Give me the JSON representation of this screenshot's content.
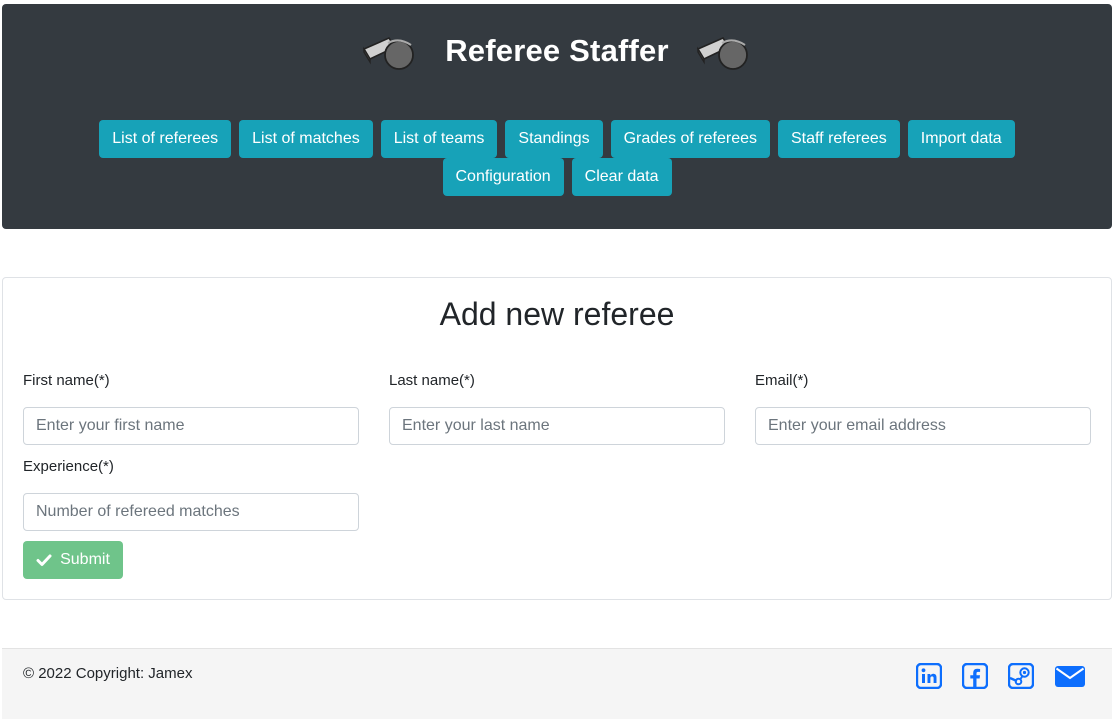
{
  "header": {
    "title": "Referee Staffer",
    "nav": [
      "List of referees",
      "List of matches",
      "List of teams",
      "Standings",
      "Grades of referees",
      "Staff referees",
      "Import data",
      "Configuration",
      "Clear data"
    ]
  },
  "form": {
    "title": "Add new referee",
    "first_name": {
      "label": "First name(*)",
      "placeholder": "Enter your first name"
    },
    "last_name": {
      "label": "Last name(*)",
      "placeholder": "Enter your last name"
    },
    "email": {
      "label": "Email(*)",
      "placeholder": "Enter your email address"
    },
    "experience": {
      "label": "Experience(*)",
      "placeholder": "Number of refereed matches"
    },
    "submit_label": "Submit"
  },
  "footer": {
    "copyright": "© 2022 Copyright: Jamex",
    "icons": [
      "linkedin-icon",
      "facebook-icon",
      "steam-icon",
      "envelope-icon"
    ]
  },
  "colors": {
    "header_bg": "#343a40",
    "nav_button": "#17a2b8",
    "submit_button": "#6fc48a",
    "social_icon": "#0d6efd",
    "footer_bg": "#f5f5f5"
  }
}
